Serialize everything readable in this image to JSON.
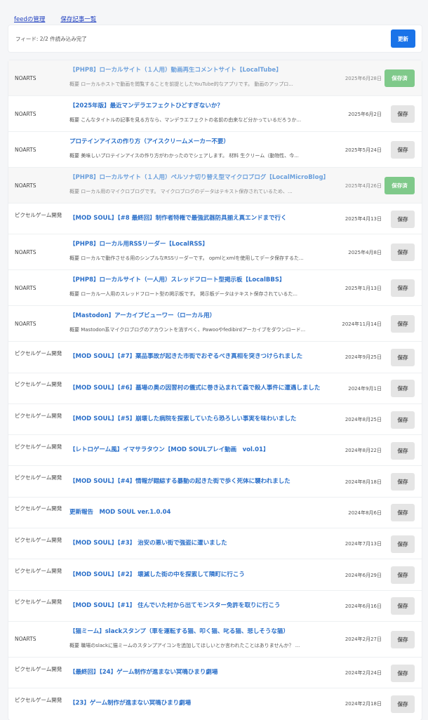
{
  "nav": {
    "feed_manage": "feedの管理",
    "saved_list": "保存記事一覧"
  },
  "status": {
    "text": "フィード: 2/2 件読み込み完了",
    "refresh_label": "更新"
  },
  "colors": {
    "accent": "#1a73e8",
    "saved_green": "#7fc98a",
    "title_blue": "#2a6fc9"
  },
  "articles": [
    {
      "source": "NOARTS",
      "title": "【PHP8】ローカルサイト（１人用）動画再生コメントサイト【LocalTube】",
      "summary": "概要 ローカルホストで動画を閲覧することを前提としたYouTube的なアプリです。 動画のアップロ...",
      "date": "2025年6月28日",
      "button": "保存済",
      "saved": true
    },
    {
      "source": "NOARTS",
      "title": "【2025年版】最近マンデラエフェクトひどすぎないか？",
      "summary": "概要 こんなタイトルの記事を見る方なら、マンデラエフェクトの名前の由来など分かっているだろうか...",
      "date": "2025年6月2日",
      "button": "保存",
      "saved": false
    },
    {
      "source": "NOARTS",
      "title": "プロテインアイスの作り方（アイスクリームメーカー不要）",
      "summary": "概要 美味しいプロテインアイスの作り方がわかったのでシェアします。 材料 生クリーム（動物性、今...",
      "date": "2025年5月24日",
      "button": "保存",
      "saved": false
    },
    {
      "source": "NOARTS",
      "title": "【PHP8】ローカルサイト（１人用）ペルソナ切り替え型マイクロブログ【LocalMicroBlog】",
      "summary": "概要 ローカル用のマイクロブログです。 マイクロブログのデータはテキスト保存されているため、...",
      "date": "2025年4月26日",
      "button": "保存済",
      "saved": true
    },
    {
      "source": "ピクセルゲーム開発",
      "title": "【MOD SOUL】【#8 最終回】制作者特権で最強武器防具揃え真エンドまで行く",
      "summary": "",
      "date": "2025年4月13日",
      "button": "保存",
      "saved": false
    },
    {
      "source": "NOARTS",
      "title": "【PHP8】ローカル用RSSリーダー【LocalRSS】",
      "summary": "概要 ローカルで動作させる用のシンプルなRSSリーダーです。 opmlとxmlを使用してデータ保存するた...",
      "date": "2025年4月8日",
      "button": "保存",
      "saved": false
    },
    {
      "source": "NOARTS",
      "title": "【PHP8】ローカルサイト（一人用）スレッドフロート型掲示板【LocalBBS】",
      "summary": "概要 ローカル一人用のスレッドフロート型の掲示板です。 掲示板データはテキスト保存されているた...",
      "date": "2025年1月13日",
      "button": "保存",
      "saved": false
    },
    {
      "source": "NOARTS",
      "title": "【Mastodon】アーカイブビューワー（ローカル用）",
      "summary": "概要 Mastodon系マイクロブログのアカウントを消すべく、Pawooやfedibirdアーカイブをダウンロード...",
      "date": "2024年11月14日",
      "button": "保存",
      "saved": false
    },
    {
      "source": "ピクセルゲーム開発",
      "title": "【MOD SOUL】【#7】薬品事故が起きた市街でおぞるべき真相を突きつけられました",
      "summary": "",
      "date": "2024年9月25日",
      "button": "保存",
      "saved": false
    },
    {
      "source": "ピクセルゲーム開発",
      "title": "【MOD SOUL】【#6】墓場の奥の因習村の儀式に巻き込まれて森で殺人事件に遭遇しました",
      "summary": "",
      "date": "2024年9月1日",
      "button": "保存",
      "saved": false
    },
    {
      "source": "ピクセルゲーム開発",
      "title": "【MOD SOUL】【#5】崩壊した病院を探索していたら恐ろしい事実を味わいました",
      "summary": "",
      "date": "2024年8月25日",
      "button": "保存",
      "saved": false
    },
    {
      "source": "ピクセルゲーム開発",
      "title": "【レトロゲーム風】イマサラタウン【MOD SOULプレイ動画　vol.01】",
      "summary": "",
      "date": "2024年8月22日",
      "button": "保存",
      "saved": false
    },
    {
      "source": "ピクセルゲーム開発",
      "title": "【MOD SOUL】【#4】情報が錯綜する暴動の起きた街で歩く死体に襲われました",
      "summary": "",
      "date": "2024年8月18日",
      "button": "保存",
      "saved": false
    },
    {
      "source": "ピクセルゲーム開発",
      "title": "更新報告　MOD SOUL ver.1.0.04",
      "summary": "",
      "date": "2024年8月6日",
      "button": "保存",
      "saved": false
    },
    {
      "source": "ピクセルゲーム開発",
      "title": "【MOD SOUL】【#3】 治安の悪い街で強盗に遭いました",
      "summary": "",
      "date": "2024年7月13日",
      "button": "保存",
      "saved": false
    },
    {
      "source": "ピクセルゲーム開発",
      "title": "【MOD SOUL】【#2】 壊滅した街の中を探索して隣町に行こう",
      "summary": "",
      "date": "2024年6月29日",
      "button": "保存",
      "saved": false
    },
    {
      "source": "ピクセルゲーム開発",
      "title": "【MOD SOUL】【#1】 住んでいた村から出てモンスター免許を取りに行こう",
      "summary": "",
      "date": "2024年6月16日",
      "button": "保存",
      "saved": false
    },
    {
      "source": "NOARTS",
      "title": "【猫ミーム】slackスタンプ（車を運転する猫、叩く猫、叱る猫、悲しそうな猫）",
      "summary": "概要 職場のslackに猫ミームのスタンプアイコンを追加してほしいとか言われたことはありませんか？ ...",
      "date": "2024年2月27日",
      "button": "保存",
      "saved": false
    },
    {
      "source": "ピクセルゲーム開発",
      "title": "【最終回】【24】ゲーム制作が進まない冥鳴ひまり劇場",
      "summary": "",
      "date": "2024年2月24日",
      "button": "保存",
      "saved": false
    },
    {
      "source": "ピクセルゲーム開発",
      "title": "【23】ゲーム制作が進まない冥鳴ひまり劇場",
      "summary": "",
      "date": "2024年2月18日",
      "button": "保存",
      "saved": false
    }
  ]
}
